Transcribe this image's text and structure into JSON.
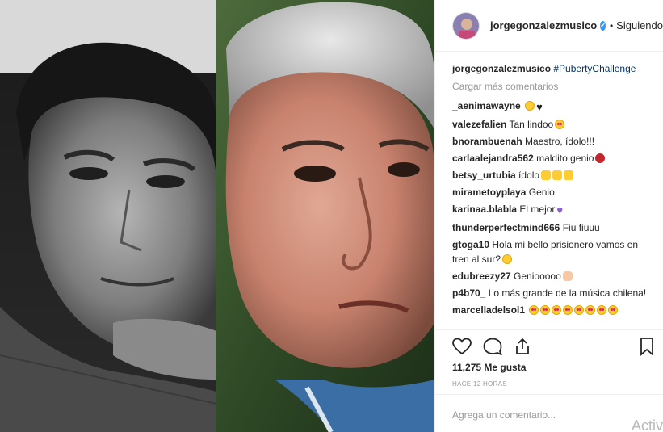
{
  "post": {
    "username": "jorgegonzalezmusico",
    "follow_status": "Siguiendo",
    "caption_user": "jorgegonzalezmusico",
    "caption_tag": "#PubertyChallenge",
    "load_more": "Cargar más comentarios",
    "likes": "11,275",
    "likes_label": "Me gusta",
    "time": "HACE 12 HORAS",
    "comment_placeholder": "Agrega un comentario...",
    "watermark": "Activ"
  },
  "comments": [
    {
      "user": "_aenimawayne",
      "text": "",
      "emoji": [
        "e-smile",
        "e-heart-black"
      ]
    },
    {
      "user": "valezefalien",
      "text": "Tan lindoo",
      "emoji": [
        "e-heart-eyes"
      ]
    },
    {
      "user": "bnorambuenah",
      "text": "Maestro, ídolo!!!",
      "emoji": []
    },
    {
      "user": "carlaalejandra562",
      "text": "maldito genio",
      "emoji": [
        "e-devil"
      ]
    },
    {
      "user": "betsy_urtubia",
      "text": "ídolo",
      "emoji": [
        "e-clap",
        "e-clap",
        "e-clap"
      ]
    },
    {
      "user": "mirametoyplaya",
      "text": "Genio",
      "emoji": []
    },
    {
      "user": "karinaa.blabla",
      "text": "El mejor",
      "emoji": [
        "e-heart-purple"
      ]
    },
    {
      "user": "thunderperfectmind666",
      "text": "Fiu fiuuu",
      "emoji": []
    },
    {
      "user": "gtoga10",
      "text": "Hola mi bello prisionero vamos en tren al sur?",
      "emoji": [
        "e-kiss"
      ]
    },
    {
      "user": "edubreezy27",
      "text": "Geniooooo",
      "emoji": [
        "e-hand"
      ]
    },
    {
      "user": "p4b70_",
      "text": "Lo más grande de la música chilena!",
      "emoji": []
    },
    {
      "user": "marcelladelsol1",
      "text": "",
      "emoji": [
        "e-heart-eyes",
        "e-heart-eyes",
        "e-heart-eyes",
        "e-heart-eyes",
        "e-heart-eyes",
        "e-heart-eyes",
        "e-heart-eyes",
        "e-heart-eyes"
      ]
    }
  ],
  "icons": {
    "like": "heart-icon",
    "comment": "comment-icon",
    "share": "share-icon",
    "save": "bookmark-icon",
    "verified": "verified-badge-icon"
  },
  "colors": {
    "verified": "#3897f0",
    "hashtag": "#003569",
    "muted": "#999999"
  }
}
